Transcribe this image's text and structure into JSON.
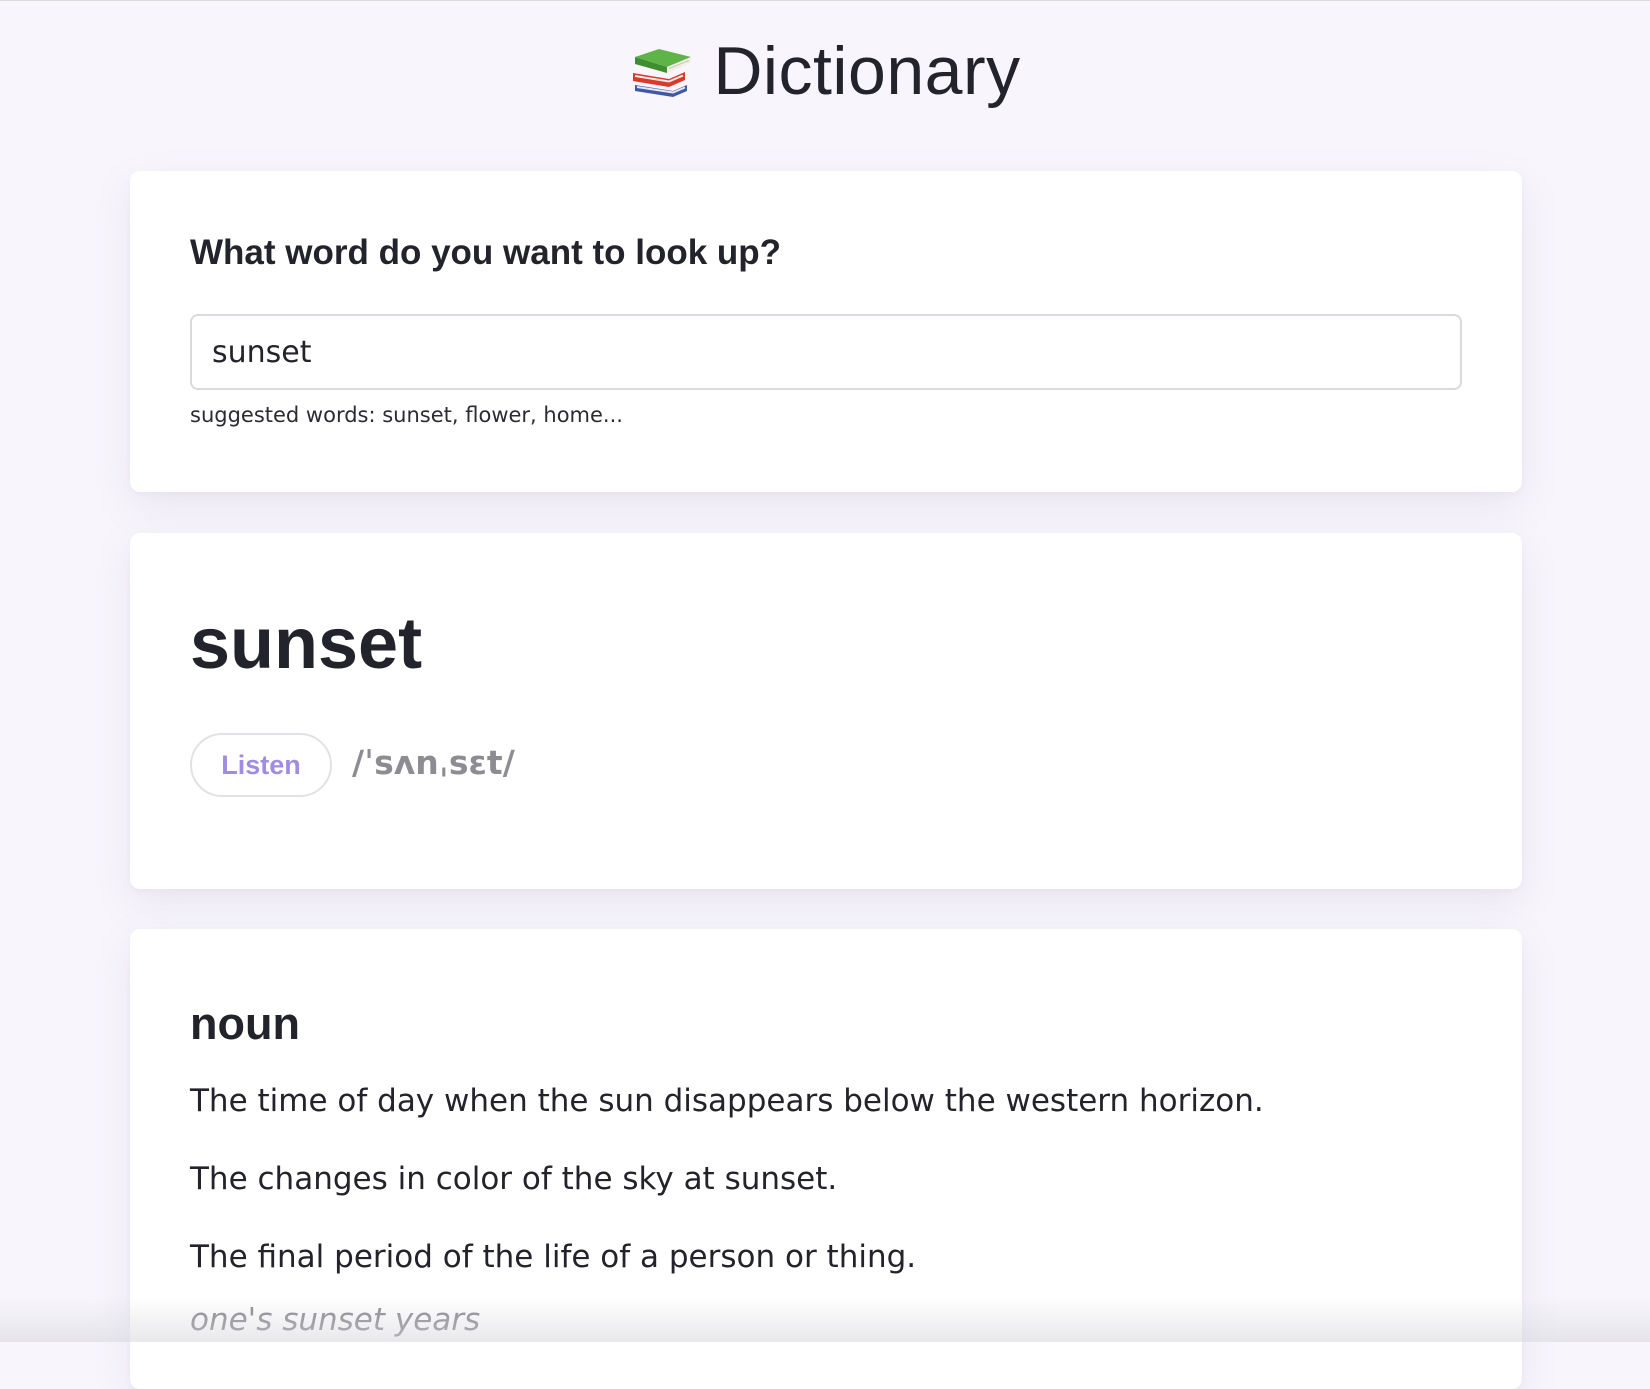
{
  "header": {
    "icon": "books-icon",
    "title": "Dictionary"
  },
  "search": {
    "question": "What word do you want to look up?",
    "value": "sunset",
    "suggestions": "suggested words: sunset, flower, home..."
  },
  "word": {
    "headword": "sunset",
    "listen_label": "Listen",
    "phonetic": "/ˈsʌnˌsɛt/"
  },
  "meaning": {
    "part_of_speech": "noun",
    "definitions": [
      "The time of day when the sun disappears below the western horizon.",
      "The changes in color of the sky at sunset.",
      "The final period of the life of a person or thing."
    ],
    "example": "one's sunset years"
  },
  "colors": {
    "page_background": "#f8f6fc",
    "card_background": "#ffffff",
    "text": "#23232b",
    "accent": "#a08ce0",
    "muted": "#8c8c92"
  }
}
